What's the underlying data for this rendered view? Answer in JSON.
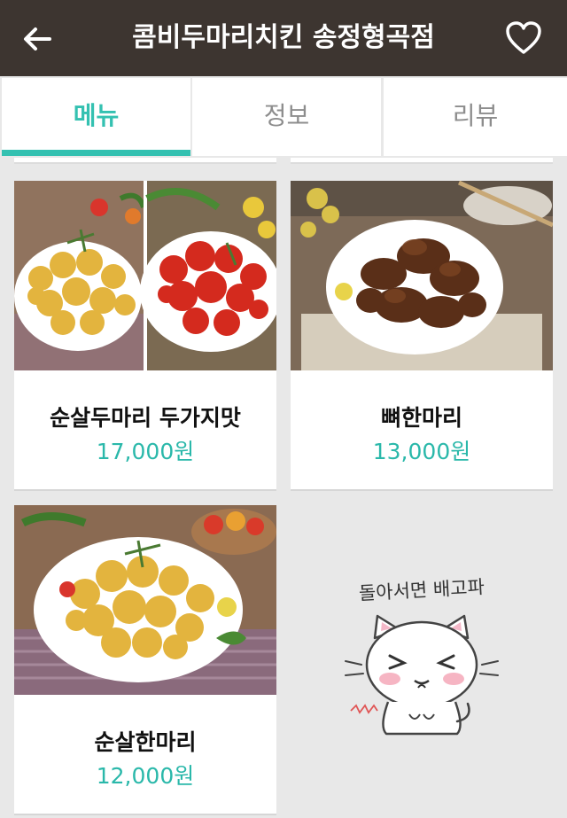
{
  "header": {
    "title": "콤비두마리치킨 송정형곡점",
    "back_icon": "arrow-left-icon",
    "favorite_icon": "heart-outline-icon",
    "background": "#3d3530"
  },
  "tabs": [
    {
      "label": "메뉴",
      "active": true
    },
    {
      "label": "정보",
      "active": false
    },
    {
      "label": "리뷰",
      "active": false
    }
  ],
  "accent_color": "#34c1b1",
  "menu": {
    "items": [
      {
        "name": "순살두마리 두가지맛",
        "price": "17,000원",
        "image": "boneless-chicken-two-flavors-photo"
      },
      {
        "name": "뼈한마리",
        "price": "13,000원",
        "image": "bone-in-soy-chicken-photo"
      },
      {
        "name": "순살한마리",
        "price": "12,000원",
        "image": "boneless-fried-chicken-photo"
      }
    ]
  },
  "mascot": {
    "caption": "돌아서면 배고파",
    "image": "white-cat-cartoon-sticker"
  }
}
